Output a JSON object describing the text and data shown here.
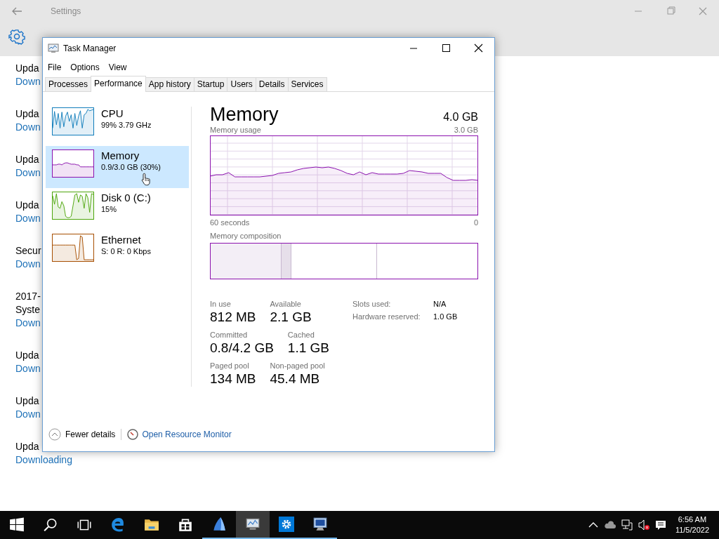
{
  "settings_window": {
    "title": "Settings",
    "updates": [
      {
        "title": [
          "Upda"
        ],
        "status": "Down"
      },
      {
        "title": [
          "Upda"
        ],
        "status": "Down"
      },
      {
        "title": [
          "Upda"
        ],
        "status": "Down"
      },
      {
        "title": [
          "Upda"
        ],
        "status": "Down"
      },
      {
        "title": [
          "Secur"
        ],
        "status": "Down"
      },
      {
        "title": [
          "2017-",
          "Syste"
        ],
        "status": "Down"
      },
      {
        "title": [
          "Upda"
        ],
        "status": "Down"
      },
      {
        "title": [
          "Upda"
        ],
        "status": "Down"
      },
      {
        "title": [
          "Upda"
        ],
        "status": "Downloading"
      }
    ]
  },
  "task_manager": {
    "title": "Task Manager",
    "menu": [
      "File",
      "Options",
      "View"
    ],
    "tabs": [
      {
        "label": "Processes",
        "selected": false
      },
      {
        "label": "Performance",
        "selected": true
      },
      {
        "label": "App history",
        "selected": false
      },
      {
        "label": "Startup",
        "selected": false
      },
      {
        "label": "Users",
        "selected": false
      },
      {
        "label": "Details",
        "selected": false
      },
      {
        "label": "Services",
        "selected": false
      }
    ],
    "sidebar": {
      "items": [
        {
          "name": "CPU",
          "detail": "99%  3.79 GHz",
          "selected": false,
          "color": "#117dbb"
        },
        {
          "name": "Memory",
          "detail": "0.9/3.0 GB (30%)",
          "selected": true,
          "color": "#8b12ae"
        },
        {
          "name": "Disk 0 (C:)",
          "detail": "15%",
          "selected": false,
          "color": "#4da60c"
        },
        {
          "name": "Ethernet",
          "detail": "S: 0 R: 0 Kbps",
          "selected": false,
          "color": "#a74f01"
        }
      ]
    },
    "detail": {
      "title": "Memory",
      "total": "4.0 GB",
      "usage_label": "Memory usage",
      "usage_max": "3.0 GB",
      "time_start": "60 seconds",
      "time_end": "0",
      "composition_label": "Memory composition",
      "stats": [
        [
          {
            "label": "In use",
            "value": "812 MB"
          },
          {
            "label": "Available",
            "value": "2.1 GB"
          }
        ],
        [
          {
            "label": "Committed",
            "value": "0.8/4.2 GB"
          },
          {
            "label": "Cached",
            "value": "1.1 GB"
          }
        ],
        [
          {
            "label": "Paged pool",
            "value": "134 MB"
          },
          {
            "label": "Non-paged pool",
            "value": "45.4 MB"
          }
        ]
      ],
      "info": [
        {
          "label": "Slots used:",
          "value": "N/A"
        },
        {
          "label": "Hardware reserved:",
          "value": "1.0 GB"
        }
      ]
    },
    "footer": {
      "fewer_details": "Fewer details",
      "resource_monitor": "Open Resource Monitor"
    }
  },
  "taskbar": {
    "buttons": [
      {
        "kind": "start",
        "selected": false,
        "running": false
      },
      {
        "kind": "search",
        "selected": false,
        "running": false
      },
      {
        "kind": "taskview",
        "selected": false,
        "running": false
      },
      {
        "kind": "browser",
        "selected": false,
        "running": false
      },
      {
        "kind": "folder",
        "selected": false,
        "running": false
      },
      {
        "kind": "store",
        "selected": false,
        "running": false
      },
      {
        "kind": "sail",
        "selected": false,
        "running": true
      },
      {
        "kind": "monitor",
        "selected": true,
        "running": true
      },
      {
        "kind": "gear",
        "selected": false,
        "running": true
      },
      {
        "kind": "screen",
        "selected": false,
        "running": true
      }
    ],
    "clock": {
      "time": "6:56 AM",
      "date": "11/5/2022"
    }
  }
}
